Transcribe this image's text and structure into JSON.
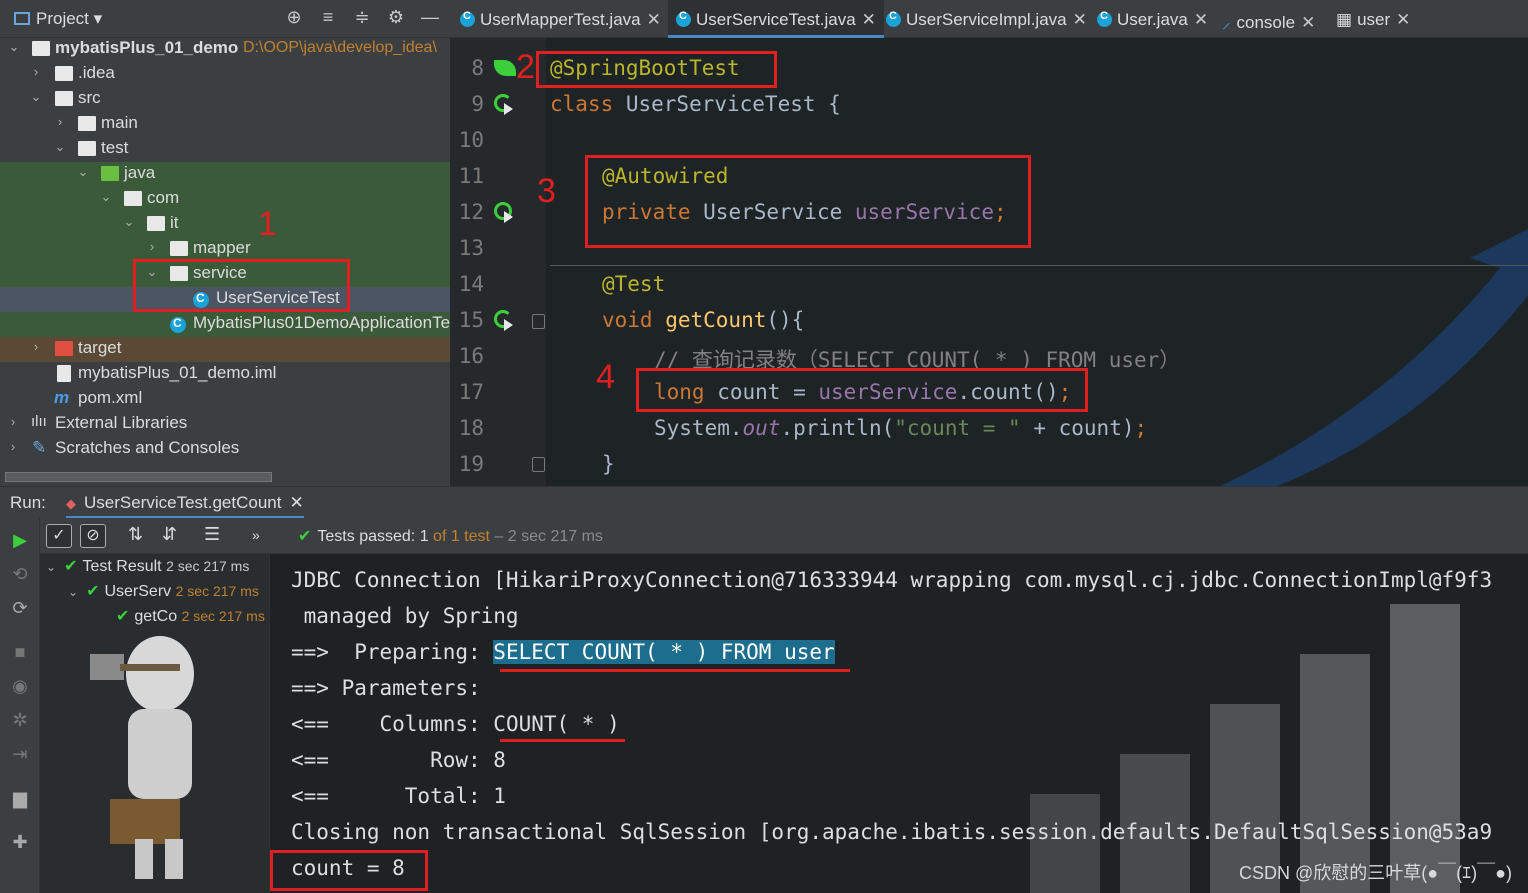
{
  "project": {
    "title": "Project",
    "root_name": "mybatisPlus_01_demo",
    "root_path": "D:\\OOP\\java\\develop_idea\\",
    "nodes": {
      "idea": ".idea",
      "src": "src",
      "main": "main",
      "test": "test",
      "java": "java",
      "com": "com",
      "it": "it",
      "mapper": "mapper",
      "service": "service",
      "service_test": "UserServiceTest",
      "app_test": "MybatisPlus01DemoApplicationTe",
      "target": "target",
      "iml": "mybatisPlus_01_demo.iml",
      "pom": "pom.xml",
      "ext_libs": "External Libraries",
      "scratches": "Scratches and Consoles"
    }
  },
  "tabs": [
    {
      "label": "UserMapperTest.java"
    },
    {
      "label": "UserServiceTest.java"
    },
    {
      "label": "UserServiceImpl.java"
    },
    {
      "label": "User.java"
    },
    {
      "label": "console"
    },
    {
      "label": "user"
    }
  ],
  "editor": {
    "line_numbers": [
      "8",
      "9",
      "10",
      "11",
      "12",
      "13",
      "14",
      "15",
      "16",
      "17",
      "18",
      "19"
    ],
    "l8_ann": "@SpringBootTest",
    "l9_kw": "class",
    "l9_rest": " UserServiceTest {",
    "l11_ann": "@Autowired",
    "l12_kw": "private",
    "l12_type": " UserService ",
    "l12_field": "userService",
    "l12_semi": ";",
    "l14_ann": "@Test",
    "l15_kw": "void",
    "l15_fn": " getCount",
    "l15_rest": "(){",
    "l16_comment": "// 查询记录数（SELECT COUNT( * ) FROM user）",
    "l17_kw": "long",
    "l17_mid": " count = ",
    "l17_field": "userService",
    "l17_call": ".count()",
    "l17_semi": ";",
    "l18_sys": "System.",
    "l18_out": "out",
    "l18_println": ".println(",
    "l18_str": "\"count = \"",
    "l18_rest": " + count)",
    "l18_semi": ";",
    "l19_brace": "}"
  },
  "marks": [
    "1",
    "2",
    "3",
    "4"
  ],
  "run": {
    "label": "Run:",
    "tab": "UserServiceTest.getCount",
    "status_prefix": "Tests passed: ",
    "status_count": "1",
    "status_of": "of 1 test",
    "status_duration": " – 2 sec 217 ms",
    "tree": [
      {
        "name": "Test Result",
        "dur": "2 sec 217 ms"
      },
      {
        "name": "UserServ",
        "dur": "2 sec 217 ms"
      },
      {
        "name": "getCo",
        "dur": "2 sec 217 ms"
      }
    ]
  },
  "console": {
    "lines": [
      "JDBC Connection [HikariProxyConnection@716333944 wrapping com.mysql.cj.jdbc.ConnectionImpl@f9f3",
      " managed by Spring",
      "==>  Preparing: ",
      "==> Parameters: ",
      "<==    Columns: ",
      "<==        Row: 8",
      "<==      Total: 1",
      "Closing non transactional SqlSession [org.apache.ibatis.session.defaults.DefaultSqlSession@53a9",
      "count = 8"
    ],
    "preparing_sql": "SELECT COUNT( * ) FROM user",
    "columns_value": "COUNT( * )"
  },
  "watermark": "CSDN @欣慰的三叶草(●￣(ｴ)￣●)",
  "colors": {
    "accent": "#4a88c7",
    "mark_red": "#e02020",
    "pass_green": "#3ccf3c"
  }
}
